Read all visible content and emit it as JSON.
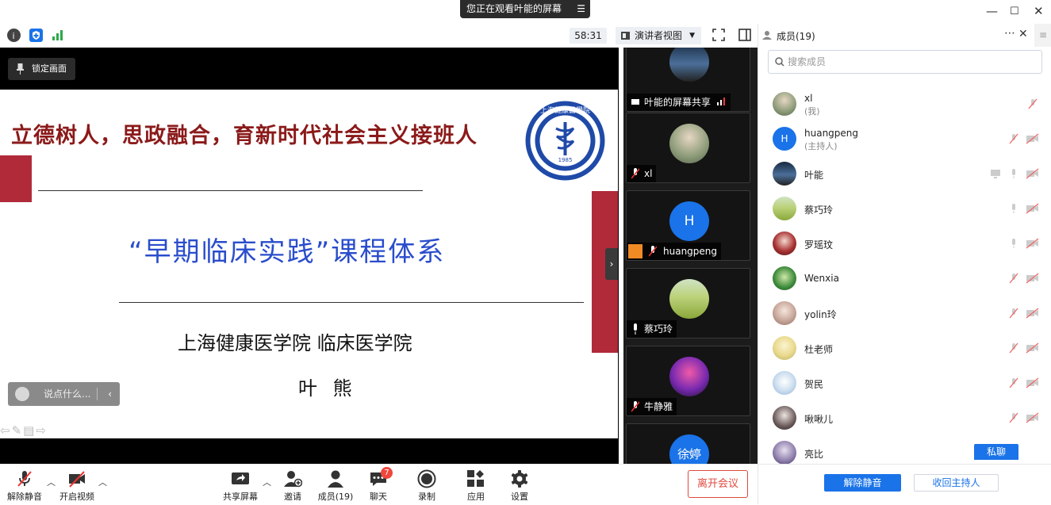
{
  "topbar": {
    "banner_text": "您正在观看叶能的屏幕",
    "timer": "58:31",
    "view_mode": "演讲者视图"
  },
  "share": {
    "lock_label": "锁定画面",
    "slide_title": "立德树人，思政融合，育新时代社会主义接班人",
    "slide_subtitle": "“早期临床实践”课程体系",
    "slide_school": "上海健康医学院    临床医学院",
    "slide_author": "叶 熊",
    "logo_text": "上海健康醫學院",
    "logo_year": "1985",
    "chat_placeholder": "说点什么..."
  },
  "gallery": {
    "tiles": [
      {
        "name": "叶能的屏幕共享"
      },
      {
        "name": "xl"
      },
      {
        "name": "huangpeng",
        "initial": "H"
      },
      {
        "name": "蔡巧玲"
      },
      {
        "name": "牛静雅"
      },
      {
        "name": "徐婷"
      }
    ]
  },
  "panel": {
    "title": "成员(19)",
    "search_placeholder": "搜索成员",
    "members": [
      {
        "name": "xl",
        "role": "(我)"
      },
      {
        "name": "huangpeng",
        "role": "(主持人)",
        "initial": "H"
      },
      {
        "name": "叶能",
        "role": ""
      },
      {
        "name": "蔡巧玲",
        "role": ""
      },
      {
        "name": "罗瑶玟",
        "role": ""
      },
      {
        "name": "Wenxia",
        "role": ""
      },
      {
        "name": "yolin玲",
        "role": ""
      },
      {
        "name": "杜老师",
        "role": ""
      },
      {
        "name": "贺民",
        "role": ""
      },
      {
        "name": "啾啾儿",
        "role": ""
      },
      {
        "name": "亮比",
        "role": ""
      }
    ],
    "private_chat": "私聊",
    "unmute_all": "解除静音",
    "reclaim_host": "收回主持人"
  },
  "toolbar": {
    "unmute": "解除静音",
    "start_video": "开启视频",
    "share_screen": "共享屏幕",
    "invite": "邀请",
    "members": "成员(19)",
    "chat": "聊天",
    "chat_badge": "7",
    "record": "录制",
    "apps": "应用",
    "settings": "设置",
    "leave": "离开会议"
  },
  "colors": {
    "accent": "#1a73e8",
    "leave": "#e04a3c",
    "slide_title": "#8b1a1a",
    "slide_subtitle": "#2a4dcc",
    "slide_bar": "#b02a3a"
  }
}
